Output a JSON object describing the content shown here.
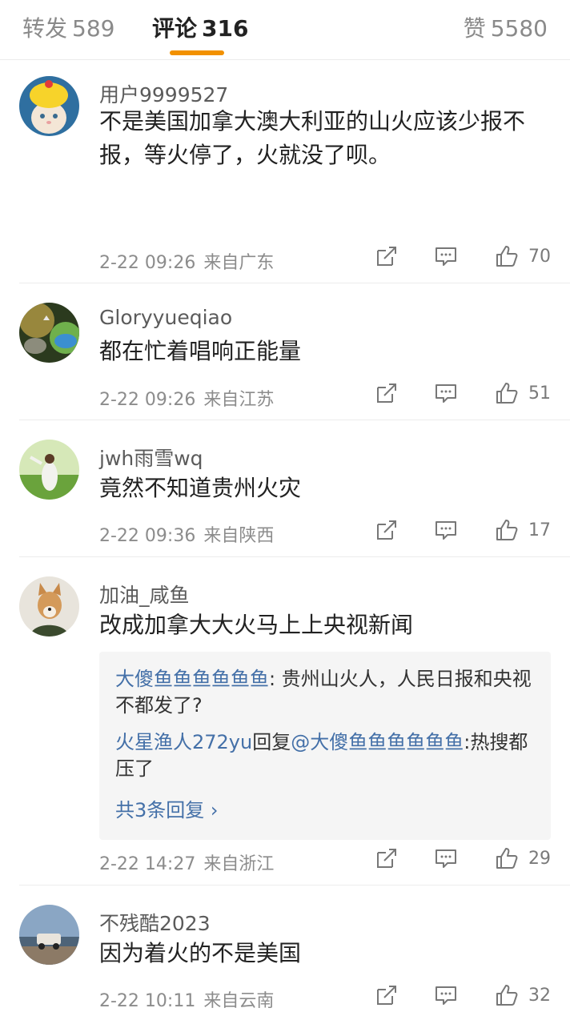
{
  "tabs": {
    "reposts": {
      "label": "转发",
      "count": "589"
    },
    "comments": {
      "label": "评论",
      "count": "316"
    },
    "likes": {
      "label": "赞",
      "count": "5580"
    }
  },
  "comments": [
    {
      "username": "用户9999527",
      "text": "不是美国加拿大澳大利亚的山火应该少报不报，等火停了，火就没了呗。",
      "time": "2-22 09:26",
      "location": "来自广东",
      "likes": "70"
    },
    {
      "username": "Gloryyueqiao",
      "text": "都在忙着唱响正能量",
      "time": "2-22 09:26",
      "location": "来自江苏",
      "likes": "51"
    },
    {
      "username": "jwh雨雪wq",
      "text": "竟然不知道贵州火灾",
      "time": "2-22 09:36",
      "location": "来自陕西",
      "likes": "17"
    },
    {
      "username": "加油_咸鱼",
      "text": "改成加拿大大火马上上央视新闻",
      "time": "2-22 14:27",
      "location": "来自浙江",
      "likes": "29",
      "replies": [
        {
          "author": "大傻鱼鱼鱼鱼鱼鱼",
          "text": ": 贵州山火人，人民日报和央视不都发了?"
        },
        {
          "author": "火星渔人272yu",
          "reply_word": "回复",
          "target": "@大傻鱼鱼鱼鱼鱼鱼",
          "text": ":热搜都压了"
        }
      ],
      "more_replies": "共3条回复 ›"
    },
    {
      "username": "不残酷2023",
      "text": "因为着火的不是美国",
      "time": "2-22 10:11",
      "location": "来自云南",
      "likes": "32"
    }
  ]
}
